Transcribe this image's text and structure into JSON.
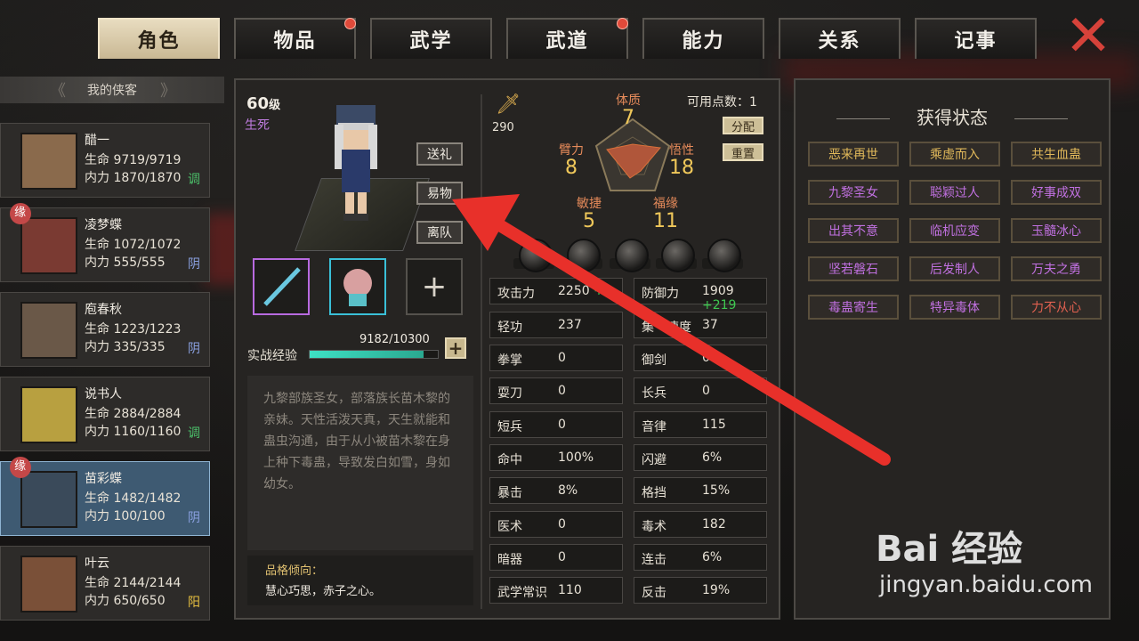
{
  "tabs": [
    {
      "label": "角色",
      "active": true,
      "dot": false
    },
    {
      "label": "物品",
      "active": false,
      "dot": true
    },
    {
      "label": "武学",
      "active": false,
      "dot": false
    },
    {
      "label": "武道",
      "active": false,
      "dot": true
    },
    {
      "label": "能力",
      "active": false,
      "dot": false
    },
    {
      "label": "关系",
      "active": false,
      "dot": false
    },
    {
      "label": "记事",
      "active": false,
      "dot": false
    }
  ],
  "close_label": "✕",
  "list": {
    "title": "我的侠客",
    "characters": [
      {
        "name": "醋一",
        "hp": "生命 9719/9719",
        "mp": "内力 1870/1870",
        "tag": "调",
        "tag_color": "#4cc06a",
        "yuan": false,
        "selected": false
      },
      {
        "name": "凌梦蝶",
        "hp": "生命 1072/1072",
        "mp": "内力 555/555",
        "tag": "阴",
        "tag_color": "#8aa0e0",
        "yuan": true,
        "selected": false
      },
      {
        "name": "庖春秋",
        "hp": "生命 1223/1223",
        "mp": "内力 335/335",
        "tag": "阴",
        "tag_color": "#8aa0e0",
        "yuan": false,
        "selected": false
      },
      {
        "name": "说书人",
        "hp": "生命 2884/2884",
        "mp": "内力 1160/1160",
        "tag": "调",
        "tag_color": "#4cc06a",
        "yuan": false,
        "selected": false
      },
      {
        "name": "苗彩蝶",
        "hp": "生命 1482/1482",
        "mp": "内力 100/100",
        "tag": "阴",
        "tag_color": "#8aa0e0",
        "yuan": true,
        "selected": true
      },
      {
        "name": "叶云",
        "hp": "生命 2144/2144",
        "mp": "内力 650/650",
        "tag": "阳",
        "tag_color": "#e8c040",
        "yuan": false,
        "selected": false
      }
    ],
    "yuan_label": "缘"
  },
  "hero": {
    "level": "60",
    "level_unit": "级",
    "life": "生死",
    "buttons": {
      "gift": "送礼",
      "trade": "易物",
      "leave": "离队"
    },
    "exp_label": "实战经验",
    "exp_value": "9182/10300",
    "exp_fraction": 0.8915,
    "exp_plus": "+",
    "description": "九黎部族圣女，部落族长苗木黎的亲妹。天性活泼天真，天生就能和蛊虫沟通，由于从小被苗木黎在身上种下毒蛊，导致发白如雪，身如幼女。",
    "trait_title": "品格倾向：",
    "trait_text": "慧心巧思，赤子之心。"
  },
  "power": "290",
  "attributes": {
    "tizhi": {
      "k": "体质",
      "v": "7"
    },
    "bili": {
      "k": "臂力",
      "v": "8"
    },
    "wuxing": {
      "k": "悟性",
      "v": "18"
    },
    "minjie": {
      "k": "敏捷",
      "v": "5"
    },
    "fuyuan": {
      "k": "福缘",
      "v": "11"
    }
  },
  "points": "可用点数：1",
  "assign_label": "分配",
  "reset_label": "重置",
  "stats_left": [
    {
      "lbl": "攻击力",
      "val": "2250",
      "bonus": "+4"
    },
    {
      "lbl": "轻功",
      "val": "237",
      "bonus": ""
    },
    {
      "lbl": "拳掌",
      "val": "0",
      "bonus": ""
    },
    {
      "lbl": "耍刀",
      "val": "0",
      "bonus": ""
    },
    {
      "lbl": "短兵",
      "val": "0",
      "bonus": ""
    },
    {
      "lbl": "命中",
      "val": "100%",
      "bonus": ""
    },
    {
      "lbl": "暴击",
      "val": "8%",
      "bonus": ""
    },
    {
      "lbl": "医术",
      "val": "0",
      "bonus": ""
    },
    {
      "lbl": "暗器",
      "val": "0",
      "bonus": ""
    },
    {
      "lbl": "武学常识",
      "val": "110",
      "bonus": ""
    }
  ],
  "stats_right": [
    {
      "lbl": "防御力",
      "val": "1909",
      "bonus": "+219"
    },
    {
      "lbl": "集气速度",
      "val": "37",
      "bonus": ""
    },
    {
      "lbl": "御剑",
      "val": "0",
      "bonus": ""
    },
    {
      "lbl": "长兵",
      "val": "0",
      "bonus": ""
    },
    {
      "lbl": "音律",
      "val": "115",
      "bonus": ""
    },
    {
      "lbl": "闪避",
      "val": "6%",
      "bonus": ""
    },
    {
      "lbl": "格挡",
      "val": "15%",
      "bonus": ""
    },
    {
      "lbl": "毒术",
      "val": "182",
      "bonus": ""
    },
    {
      "lbl": "连击",
      "val": "6%",
      "bonus": ""
    },
    {
      "lbl": "反击",
      "val": "19%",
      "bonus": ""
    }
  ],
  "status_panel": {
    "title": "获得状态",
    "items": [
      {
        "text": "恶来再世",
        "color": "#e0b85a"
      },
      {
        "text": "乘虚而入",
        "color": "#e0b85a"
      },
      {
        "text": "共生血蛊",
        "color": "#e0b85a"
      },
      {
        "text": "九黎圣女",
        "color": "#c070e0"
      },
      {
        "text": "聪颖过人",
        "color": "#c070e0"
      },
      {
        "text": "好事成双",
        "color": "#c070e0"
      },
      {
        "text": "出其不意",
        "color": "#c070e0"
      },
      {
        "text": "临机应变",
        "color": "#c070e0"
      },
      {
        "text": "玉髓冰心",
        "color": "#c070e0"
      },
      {
        "text": "坚若磐石",
        "color": "#c070e0"
      },
      {
        "text": "后发制人",
        "color": "#c070e0"
      },
      {
        "text": "万夫之勇",
        "color": "#c070e0"
      },
      {
        "text": "毒蛊寄生",
        "color": "#c070e0"
      },
      {
        "text": "特异毒体",
        "color": "#c070e0"
      },
      {
        "text": "力不从心",
        "color": "#e06050"
      }
    ]
  },
  "watermark": {
    "brand": "Bai 经验",
    "url": "jingyan.baidu.com"
  }
}
